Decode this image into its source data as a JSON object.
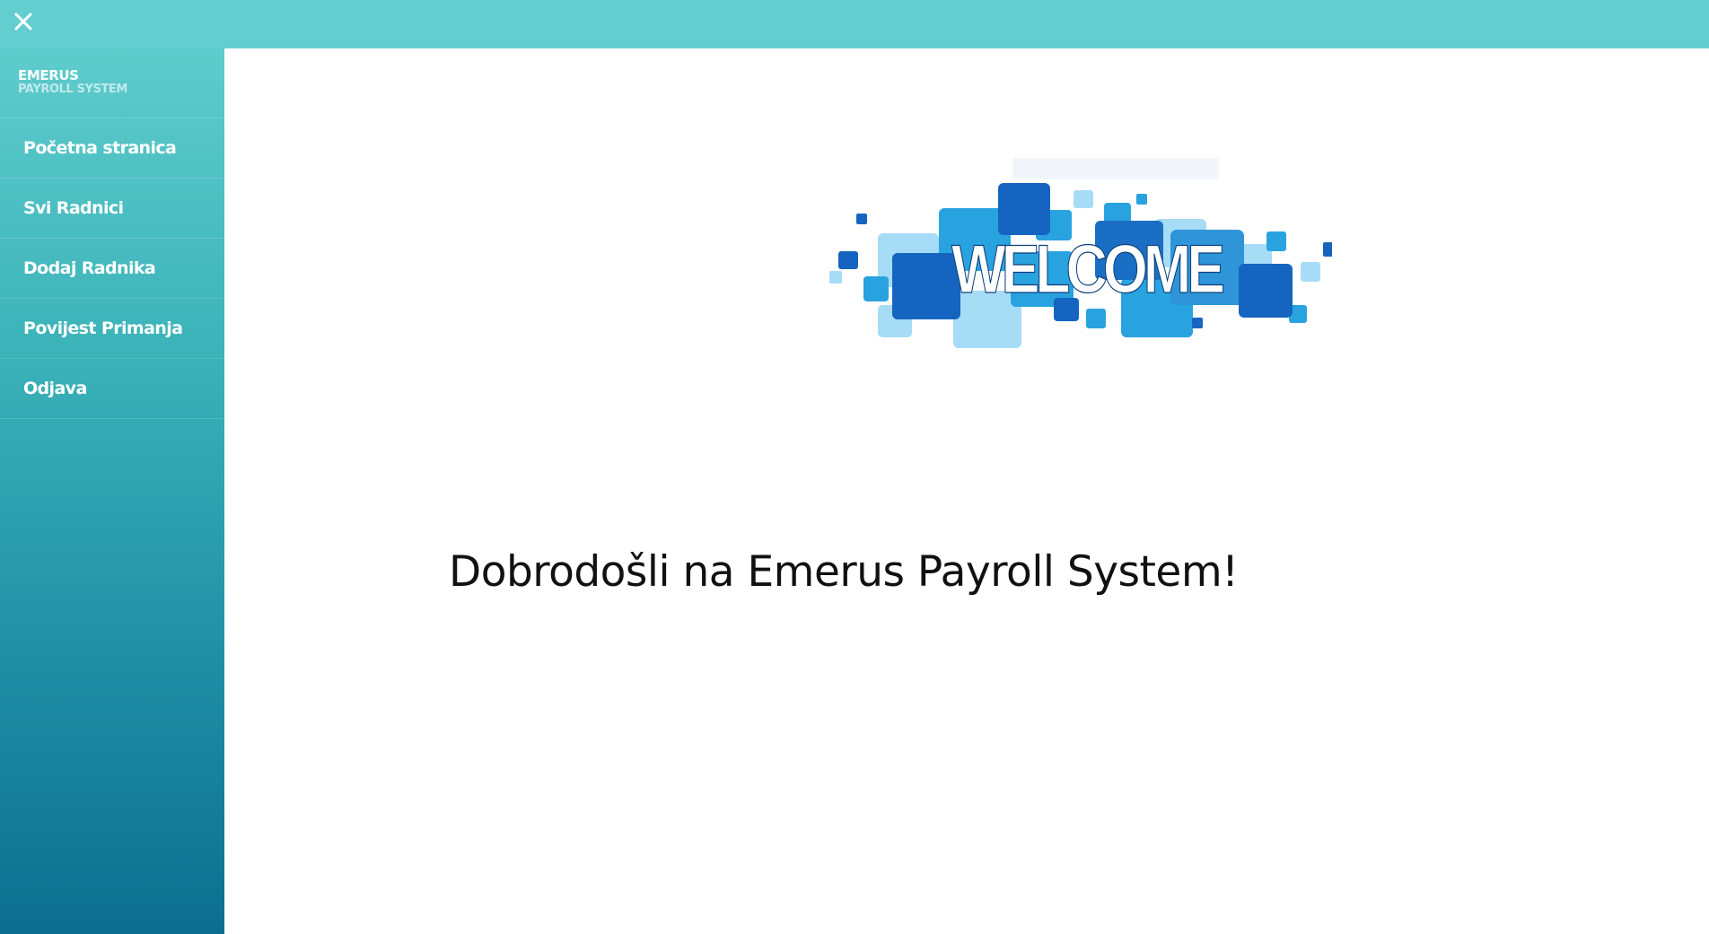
{
  "topbar": {
    "close_icon": "close-icon"
  },
  "sidebar": {
    "brand_name": "EMERUS",
    "brand_subtitle": "PAYROLL SYSTEM",
    "items": [
      {
        "label": "Početna stranica"
      },
      {
        "label": "Svi Radnici"
      },
      {
        "label": "Dodaj Radnika"
      },
      {
        "label": "Povijest Primanja"
      },
      {
        "label": "Odjava"
      }
    ]
  },
  "main": {
    "banner_text": "WELCOME",
    "heading": "Dobrodošli na Emerus Payroll System!"
  },
  "colors": {
    "topbar": "#62ced0",
    "sidebar_top": "#5fcccc",
    "sidebar_bottom": "#0c6e8f",
    "banner_dark": "#1565c0",
    "banner_mid": "#29a3e0",
    "banner_light": "#a7dcf7"
  }
}
